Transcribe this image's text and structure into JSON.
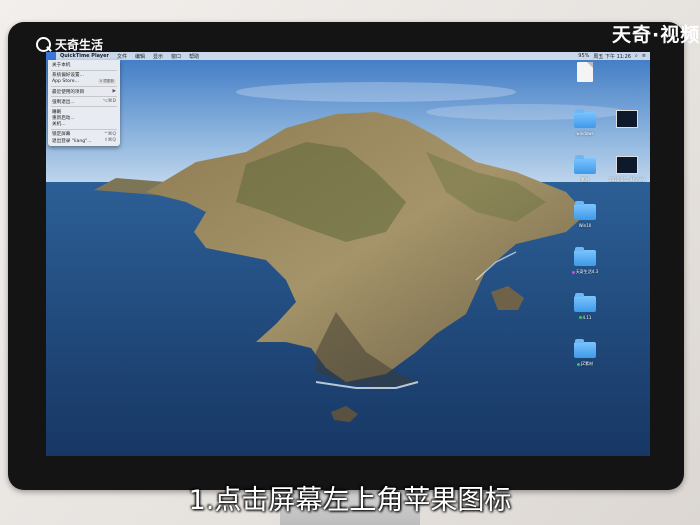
{
  "watermark": {
    "brand": "天奇生活",
    "corner_brand": "天奇·视频"
  },
  "menubar": {
    "apple_icon": "apple-logo-icon",
    "app_name": "QuickTime Player",
    "items": [
      "文件",
      "编辑",
      "显示",
      "窗口",
      "帮助"
    ],
    "status": {
      "battery": "95%",
      "time": "周五 下午 11:26"
    }
  },
  "apple_menu": {
    "items": [
      {
        "label": "关于本机",
        "shortcut": ""
      },
      {
        "sep": true
      },
      {
        "label": "系统偏好设置...",
        "shortcut": ""
      },
      {
        "label": "App Store...",
        "badge": "0 项更新"
      },
      {
        "sep": true
      },
      {
        "label": "最近使用的项目",
        "shortcut": "▶"
      },
      {
        "sep": true
      },
      {
        "label": "强制退出...",
        "shortcut": "⌥⌘D"
      },
      {
        "sep": true
      },
      {
        "label": "睡眠",
        "shortcut": ""
      },
      {
        "label": "重新启动...",
        "shortcut": ""
      },
      {
        "label": "关机...",
        "shortcut": ""
      },
      {
        "sep": true
      },
      {
        "label": "锁定屏幕",
        "shortcut": "^⌘Q"
      },
      {
        "label": "退出登录 \"liang\"...",
        "shortcut": "⇧⌘Q"
      }
    ]
  },
  "desktop_icons": [
    {
      "type": "doc",
      "label": ""
    },
    {
      "type": "folder",
      "label": "windows"
    },
    {
      "type": "folder",
      "label": "素材"
    },
    {
      "type": "folder",
      "label": "Win10"
    },
    {
      "type": "folder",
      "label": "天奇生活4.3",
      "tag": "#b05cd6"
    },
    {
      "type": "folder",
      "label": "4.11",
      "tag": "#3ac45a"
    },
    {
      "type": "folder",
      "label": "JZ素材",
      "tag": "#3ac45a"
    },
    {
      "type": "thumb",
      "label": ""
    },
    {
      "type": "thumb",
      "label": "2022-05...44.mov"
    }
  ],
  "subtitle": "1.点击屏幕左上角苹果图标"
}
